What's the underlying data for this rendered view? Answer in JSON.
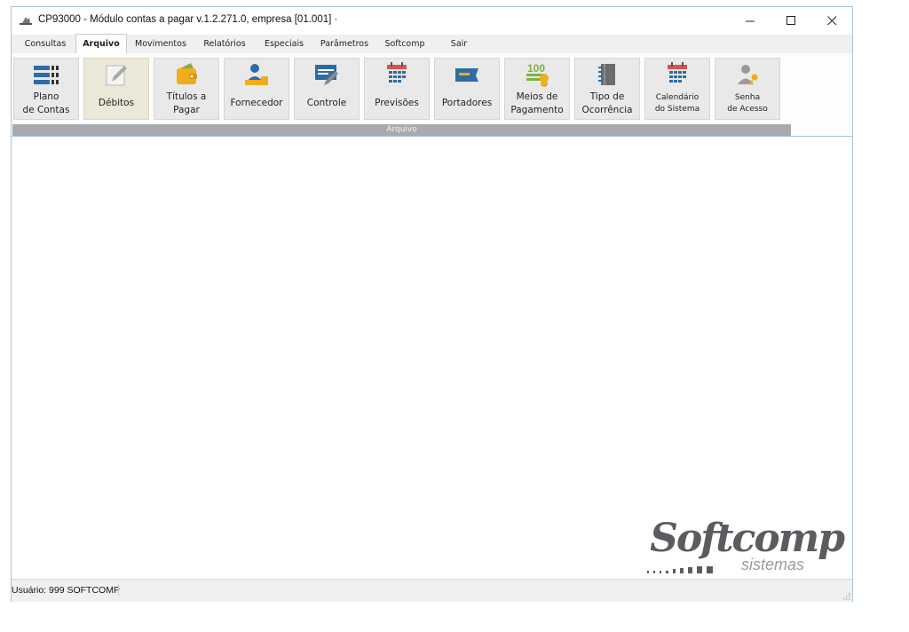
{
  "window": {
    "title": "CP93000 - Módulo contas a pagar v.1.2.271.0, empresa [01.001] ·",
    "controls": {
      "minimize": "—",
      "maximize": "☐",
      "close": "✕"
    }
  },
  "menu": [
    {
      "label": "Consultas"
    },
    {
      "label": "Arquivo",
      "active": true
    },
    {
      "label": "Movimentos"
    },
    {
      "label": "Relatórios"
    },
    {
      "label": "Especiais"
    },
    {
      "label": "Parâmetros"
    },
    {
      "label": "Softcomp"
    },
    {
      "label": "Sair"
    }
  ],
  "ribbon": {
    "group_label": "Arquivo",
    "buttons": [
      {
        "label": "Plano\nde Contas",
        "icon": "list-icon"
      },
      {
        "label": "Débitos",
        "icon": "pencil-icon",
        "selected": true
      },
      {
        "label": "Títulos a\nPagar",
        "icon": "wallet-icon"
      },
      {
        "label": "Fornecedor",
        "icon": "person-icon"
      },
      {
        "label": "Controle",
        "icon": "edit-window-icon"
      },
      {
        "label": "Previsões",
        "icon": "calendar-icon"
      },
      {
        "label": "Portadores",
        "icon": "tag-icon"
      },
      {
        "label": "Meios de\nPagamento",
        "icon": "money-icon",
        "badge": "100"
      },
      {
        "label": "Tipo de\nOcorrência",
        "icon": "notebook-icon"
      },
      {
        "label": "Calendário\ndo Sistema",
        "icon": "calendar-icon",
        "small": true
      },
      {
        "label": "Senha\nde Acesso",
        "icon": "user-key-icon",
        "small": true
      }
    ]
  },
  "logo": {
    "brand": "Softcomp",
    "sub": "sistemas"
  },
  "status": {
    "user": "Usuário: 999 SOFTCOMP"
  },
  "colors": {
    "icon_blue": "#2e6da4",
    "icon_red": "#d9534f",
    "icon_yellow": "#f0ad1c",
    "icon_green": "#7cb342",
    "ribbon_group": "#a7abb0"
  }
}
